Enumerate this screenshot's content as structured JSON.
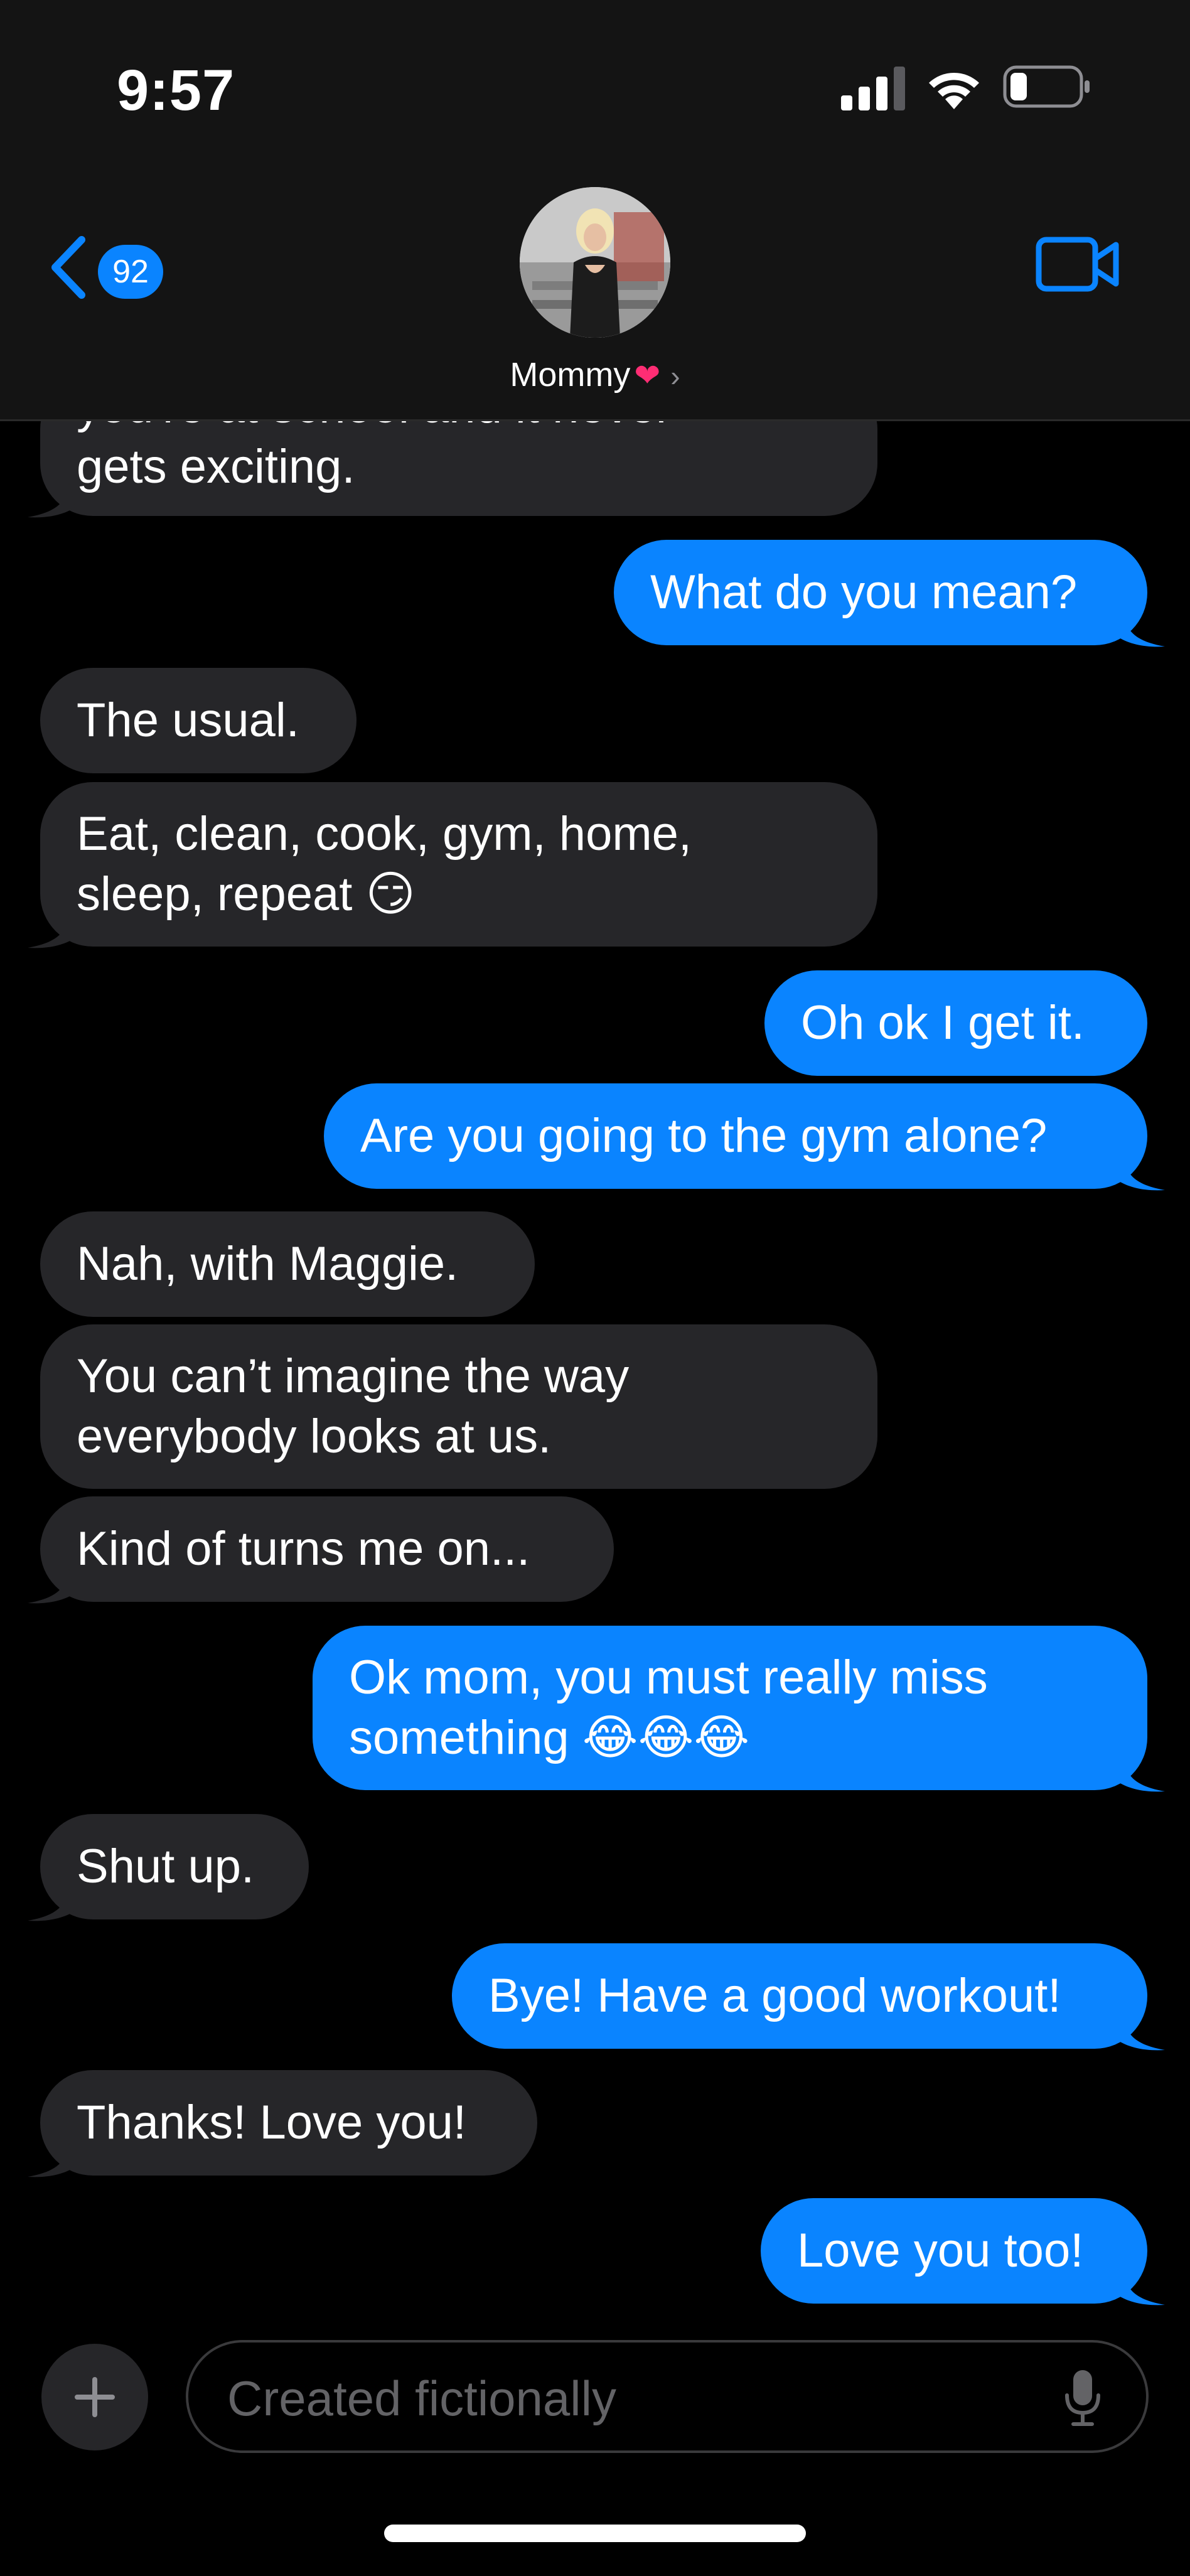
{
  "status_bar": {
    "time": "9:57"
  },
  "header": {
    "back_badge": "92",
    "contact_name": "Mommy",
    "contact_emoji": "❤",
    "chevron": "›"
  },
  "messages": [
    {
      "from": "them",
      "lines": [
        "you're at school and it never",
        "gets exciting."
      ]
    },
    {
      "from": "me",
      "lines": [
        "What do you mean?"
      ]
    },
    {
      "from": "them",
      "lines": [
        "The usual."
      ]
    },
    {
      "from": "them",
      "lines": [
        "Eat, clean, cook, gym, home,",
        "sleep, repeat 😏"
      ]
    },
    {
      "from": "me",
      "lines": [
        "Oh ok I get it."
      ]
    },
    {
      "from": "me",
      "lines": [
        "Are you going to the gym alone?"
      ]
    },
    {
      "from": "them",
      "lines": [
        "Nah, with Maggie."
      ]
    },
    {
      "from": "them",
      "lines": [
        "You can’t imagine the way",
        "everybody looks at us."
      ]
    },
    {
      "from": "them",
      "lines": [
        "Kind of turns me on..."
      ]
    },
    {
      "from": "me",
      "lines": [
        "Ok mom, you must really miss",
        "something 😂😂😂"
      ]
    },
    {
      "from": "them",
      "lines": [
        "Shut up."
      ]
    },
    {
      "from": "me",
      "lines": [
        "Bye! Have a good workout!"
      ]
    },
    {
      "from": "them",
      "lines": [
        "Thanks! Love you!"
      ]
    },
    {
      "from": "me",
      "lines": [
        "Love you too!"
      ]
    }
  ],
  "composer": {
    "placeholder": "Created fictionally"
  },
  "icons": {
    "back": "chevron-left-icon",
    "video": "video-camera-icon",
    "plus": "plus-icon",
    "mic": "microphone-icon"
  },
  "colors": {
    "accent": "#0a84ff",
    "incoming_bubble": "#262629",
    "background": "#000000"
  }
}
